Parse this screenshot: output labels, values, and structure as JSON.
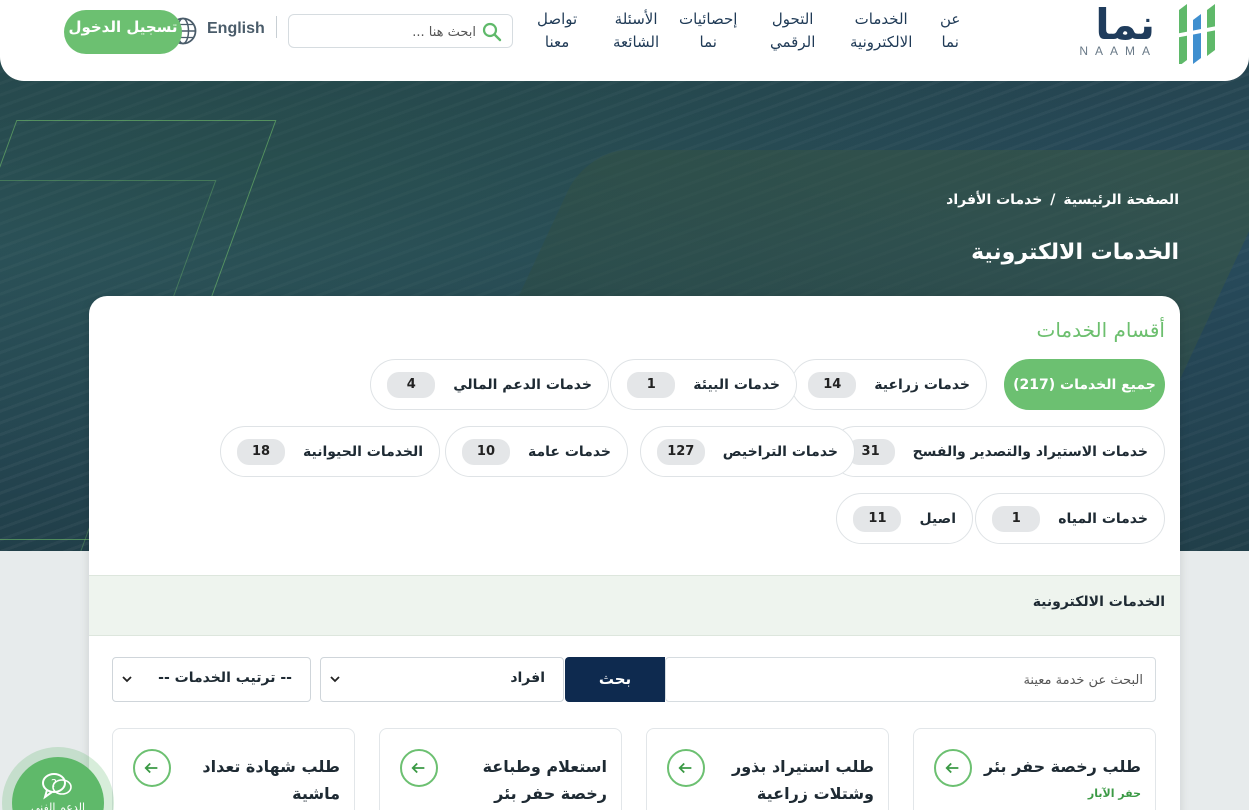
{
  "header": {
    "logo_word": "نما",
    "logo_latin": "NAAMA",
    "nav": [
      {
        "line1": "عن",
        "line2": "نما"
      },
      {
        "line1": "الخدمات",
        "line2": "الالكترونية"
      },
      {
        "line1": "التحول",
        "line2": "الرقمي"
      },
      {
        "line1": "إحصائيات",
        "line2": "نما"
      },
      {
        "line1": "الأسئلة",
        "line2": "الشائعة"
      },
      {
        "line1": "تواصل",
        "line2": "معنا"
      }
    ],
    "search_placeholder": "ابحث هنا ...",
    "language": "English",
    "login_label": "تسجيل الدخول"
  },
  "breadcrumb": {
    "home": "الصفحة الرئيسية",
    "separator": "/",
    "current": "خدمات الأفراد"
  },
  "page_title": "الخدمات الالكترونية",
  "categories": {
    "title": "أقسام الخدمات",
    "items": [
      {
        "label": "جميع الخدمات (217)",
        "count": ""
      },
      {
        "label": "خدمات زراعية",
        "count": "14"
      },
      {
        "label": "خدمات البيئة",
        "count": "1"
      },
      {
        "label": "خدمات الدعم المالي",
        "count": "4"
      },
      {
        "label": "خدمات الاستيراد والتصدير والفسح",
        "count": "31"
      },
      {
        "label": "خدمات التراخيص",
        "count": "127"
      },
      {
        "label": "خدمات عامة",
        "count": "10"
      },
      {
        "label": "الخدمات الحيوانية",
        "count": "18"
      },
      {
        "label": "خدمات المياه",
        "count": "1"
      },
      {
        "label": "اصيل",
        "count": "11"
      }
    ]
  },
  "services_section": {
    "title": "الخدمات الالكترونية",
    "search_placeholder": "البحث عن خدمة معينة",
    "search_button": "بحث",
    "beneficiary_select": "افراد",
    "sort_select": "-- ترتيب الخدمات --"
  },
  "service_cards": [
    {
      "title": "طلب رخصة حفر بئر",
      "subtitle": "حفر الآبار"
    },
    {
      "title": "طلب استيراد بذور وشتلات زراعية",
      "subtitle": ""
    },
    {
      "title": "استعلام وطباعة رخصة حفر بئر",
      "subtitle": ""
    },
    {
      "title": "طلب شهادة تعداد ماشية",
      "subtitle": ""
    }
  ],
  "support": {
    "label": "الدعم الفني"
  },
  "colors": {
    "primary_green": "#6cc071",
    "navy": "#0e2a4f",
    "text_dark": "#1e2a33"
  }
}
